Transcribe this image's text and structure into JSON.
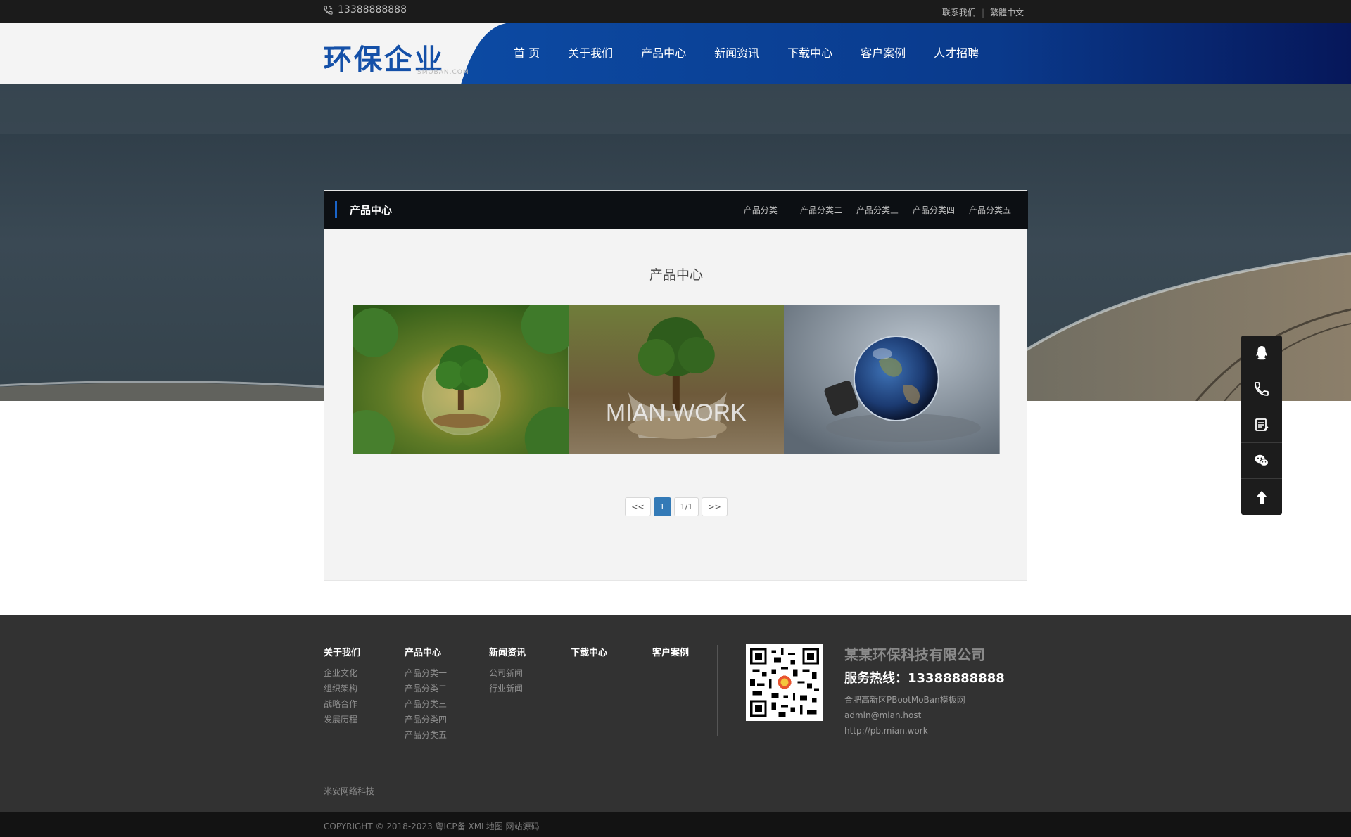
{
  "topbar": {
    "phone": "13388888888",
    "contact": "联系我们",
    "separator": "|",
    "language": "繁體中文"
  },
  "header": {
    "logo": "环保企业",
    "logo_sub": "SMOBAN.COM",
    "nav": [
      "首 页",
      "关于我们",
      "产品中心",
      "新闻资讯",
      "下载中心",
      "客户案例",
      "人才招聘"
    ],
    "nav_color": "#0d49a1"
  },
  "content": {
    "head_title": "产品中心",
    "categories": [
      "产品分类一",
      "产品分类二",
      "产品分类三",
      "产品分类四",
      "产品分类五"
    ],
    "section_title": "产品中心",
    "products": [
      {
        "icon": "tree-in-glass-image"
      },
      {
        "icon": "tree-in-broken-glass-image",
        "overlay": "MIAN.WORK"
      },
      {
        "icon": "earth-lightbulb-image"
      }
    ],
    "pager": {
      "prev": "<<",
      "current": "1",
      "total": "1/1",
      "next": ">>"
    }
  },
  "sidetools": [
    "qq-icon",
    "phone-icon",
    "message-icon",
    "wechat-icon",
    "arrow-up-icon"
  ],
  "footer": {
    "columns": [
      {
        "title": "关于我们",
        "items": [
          "企业文化",
          "组织架构",
          "战略合作",
          "发展历程"
        ]
      },
      {
        "title": "产品中心",
        "items": [
          "产品分类一",
          "产品分类二",
          "产品分类三",
          "产品分类四",
          "产品分类五"
        ]
      },
      {
        "title": "新闻资讯",
        "items": [
          "公司新闻",
          "行业新闻"
        ]
      },
      {
        "title": "下载中心",
        "items": []
      },
      {
        "title": "客户案例",
        "items": []
      }
    ],
    "company_name": "某某环保科技有限公司",
    "hotline": "服务热线：13388888888",
    "address": "合肥高新区PBootMoBan模板网",
    "email": "admin@mian.host",
    "website": "http://pb.mian.work",
    "brand": "米安网络科技"
  },
  "copyright": "COPYRIGHT © 2018-2023 粤ICP备 XML地图 网站源码"
}
